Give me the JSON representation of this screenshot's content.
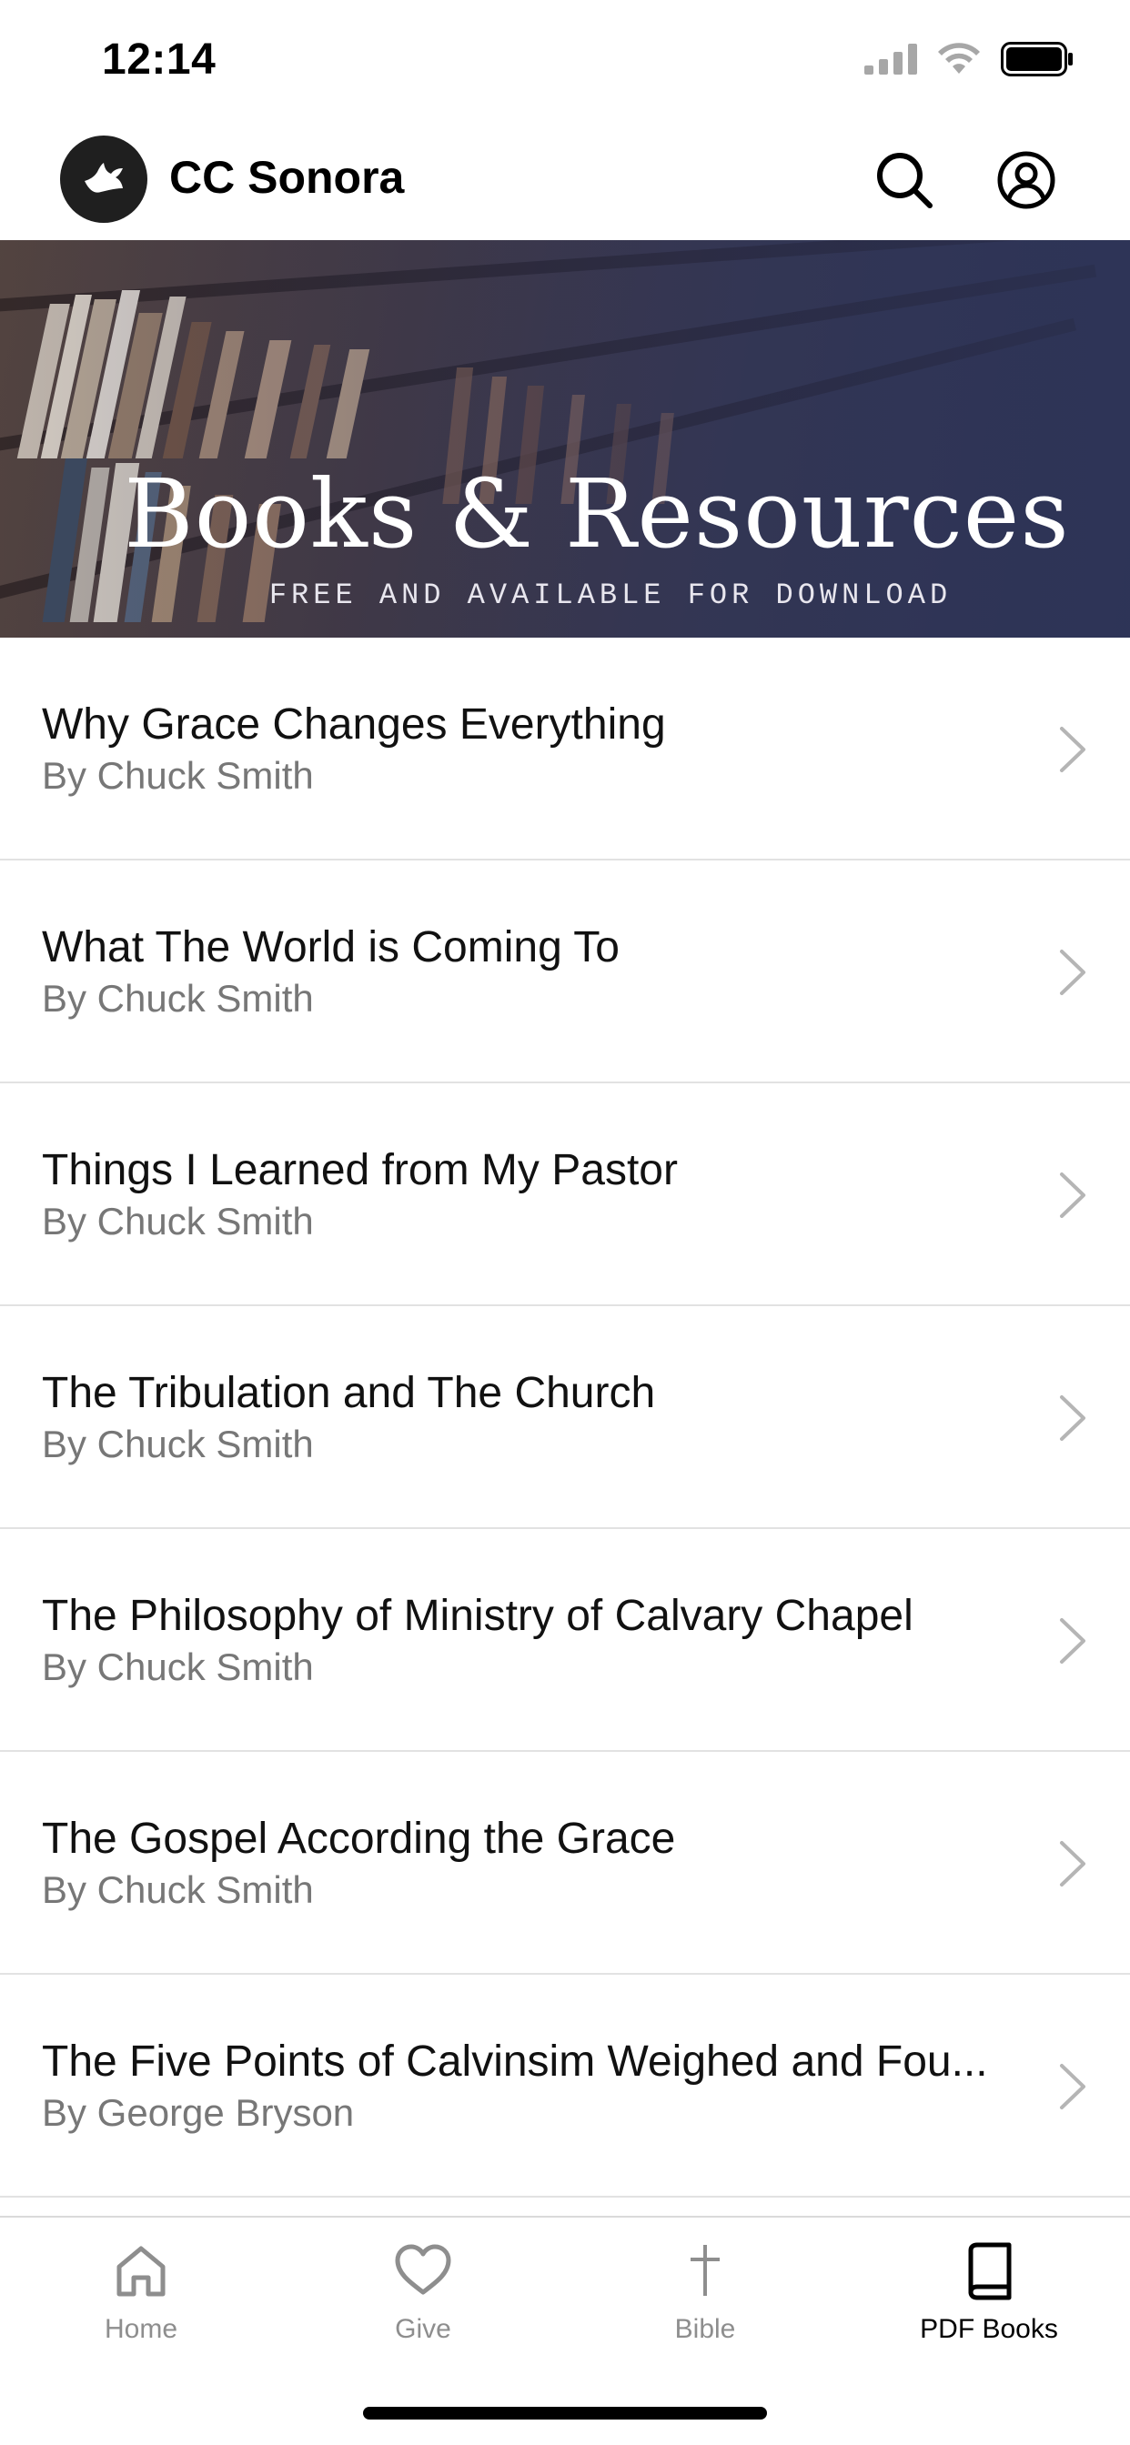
{
  "status_bar": {
    "time": "12:14",
    "icons": [
      "cellular-signal-icon",
      "wifi-icon",
      "battery-icon"
    ]
  },
  "header": {
    "title": "CC Sonora",
    "logo_icon": "dove-icon",
    "search_icon": "search-icon",
    "profile_icon": "user-circle-icon"
  },
  "banner": {
    "title": "Books & Resources",
    "subtitle": "FREE AND AVAILABLE FOR DOWNLOAD"
  },
  "books": [
    {
      "title": "Why Grace Changes Everything",
      "author": "By Chuck Smith"
    },
    {
      "title": "What The World is Coming To",
      "author": "By Chuck Smith"
    },
    {
      "title": "Things I Learned from My Pastor",
      "author": "By Chuck Smith"
    },
    {
      "title": "The Tribulation and The Church",
      "author": "By Chuck Smith"
    },
    {
      "title": "The Philosophy of Ministry of Calvary Chapel",
      "author": "By Chuck Smith"
    },
    {
      "title": "The Gospel According the Grace",
      "author": "By Chuck Smith"
    },
    {
      "title": "The Five Points of Calvinsim Weighed and Fou...",
      "author": "By George Bryson"
    }
  ],
  "tabs": [
    {
      "label": "Home",
      "icon": "home-icon",
      "active": false
    },
    {
      "label": "Give",
      "icon": "heart-icon",
      "active": false
    },
    {
      "label": "Bible",
      "icon": "cross-icon",
      "active": false
    },
    {
      "label": "PDF Books",
      "icon": "book-icon",
      "active": true
    }
  ],
  "colors": {
    "text_primary": "#111111",
    "text_secondary": "#777777",
    "tab_inactive": "#8e8e8e",
    "tab_active": "#000000",
    "banner_bg": "#3a3a52"
  }
}
